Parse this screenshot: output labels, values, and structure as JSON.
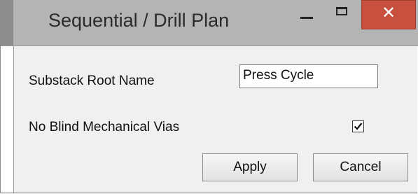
{
  "window": {
    "title": "Sequential / Drill Plan",
    "controls": {
      "minimize_icon": "minimize-icon",
      "maximize_icon": "maximize-icon",
      "close_icon": "close-icon",
      "close_glyph": "✕",
      "close_color": "#c7503f"
    }
  },
  "form": {
    "root_name_label": "Substack Root Name",
    "root_name_value": "Press Cycle",
    "no_blind_vias_label": "No Blind Mechanical Vias",
    "no_blind_vias_checked": true
  },
  "buttons": {
    "apply_label": "Apply",
    "cancel_label": "Cancel"
  }
}
